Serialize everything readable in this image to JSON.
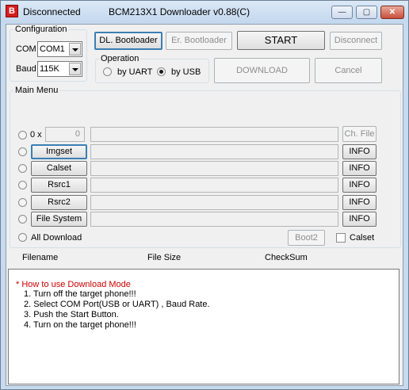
{
  "titlebar": {
    "icon_letter": "B",
    "status": "Disconnected",
    "title": "BCM213X1 Downloader v0.88(C)",
    "minimize": "—",
    "maximize": "▢",
    "close": "✕"
  },
  "configuration": {
    "legend": "Configuration",
    "com_label": "COM",
    "com_value": "COM1",
    "baud_label": "Baud",
    "baud_value": "115K"
  },
  "toolbar": {
    "dl_bootloader": "DL. Bootloader",
    "er_bootloader": "Er. Bootloader",
    "start": "START",
    "disconnect": "Disconnect",
    "download": "DOWNLOAD",
    "cancel": "Cancel"
  },
  "operation": {
    "legend": "Operation",
    "by_uart": "by UART",
    "by_usb": "by USB",
    "selected": "by USB"
  },
  "main_menu": {
    "legend": "Main Menu",
    "count_label": "0 x",
    "count_value": "0",
    "ch_file": "Ch. File",
    "rows": [
      {
        "name": "Imgset",
        "info": "INFO"
      },
      {
        "name": "Calset",
        "info": "INFO"
      },
      {
        "name": "Rsrc1",
        "info": "INFO"
      },
      {
        "name": "Rsrc2",
        "info": "INFO"
      },
      {
        "name": "File System",
        "info": "INFO"
      }
    ],
    "all_download": "All Download",
    "boot2": "Boot2",
    "calset_check": "Calset"
  },
  "file_table": {
    "col_filename": "Filename",
    "col_filesize": "File Size",
    "col_checksum": "CheckSum"
  },
  "log": {
    "heading": "* How to use Download Mode",
    "steps": [
      "1. Turn off the target phone!!!",
      "2. Select COM Port(USB or UART) , Baud Rate.",
      "3. Push the Start Button.",
      "4. Turn on the target phone!!!"
    ]
  },
  "colors": {
    "accent": "#3c7fb1",
    "warning_text": "#cc0000",
    "titlebar": "#c8dbee"
  }
}
